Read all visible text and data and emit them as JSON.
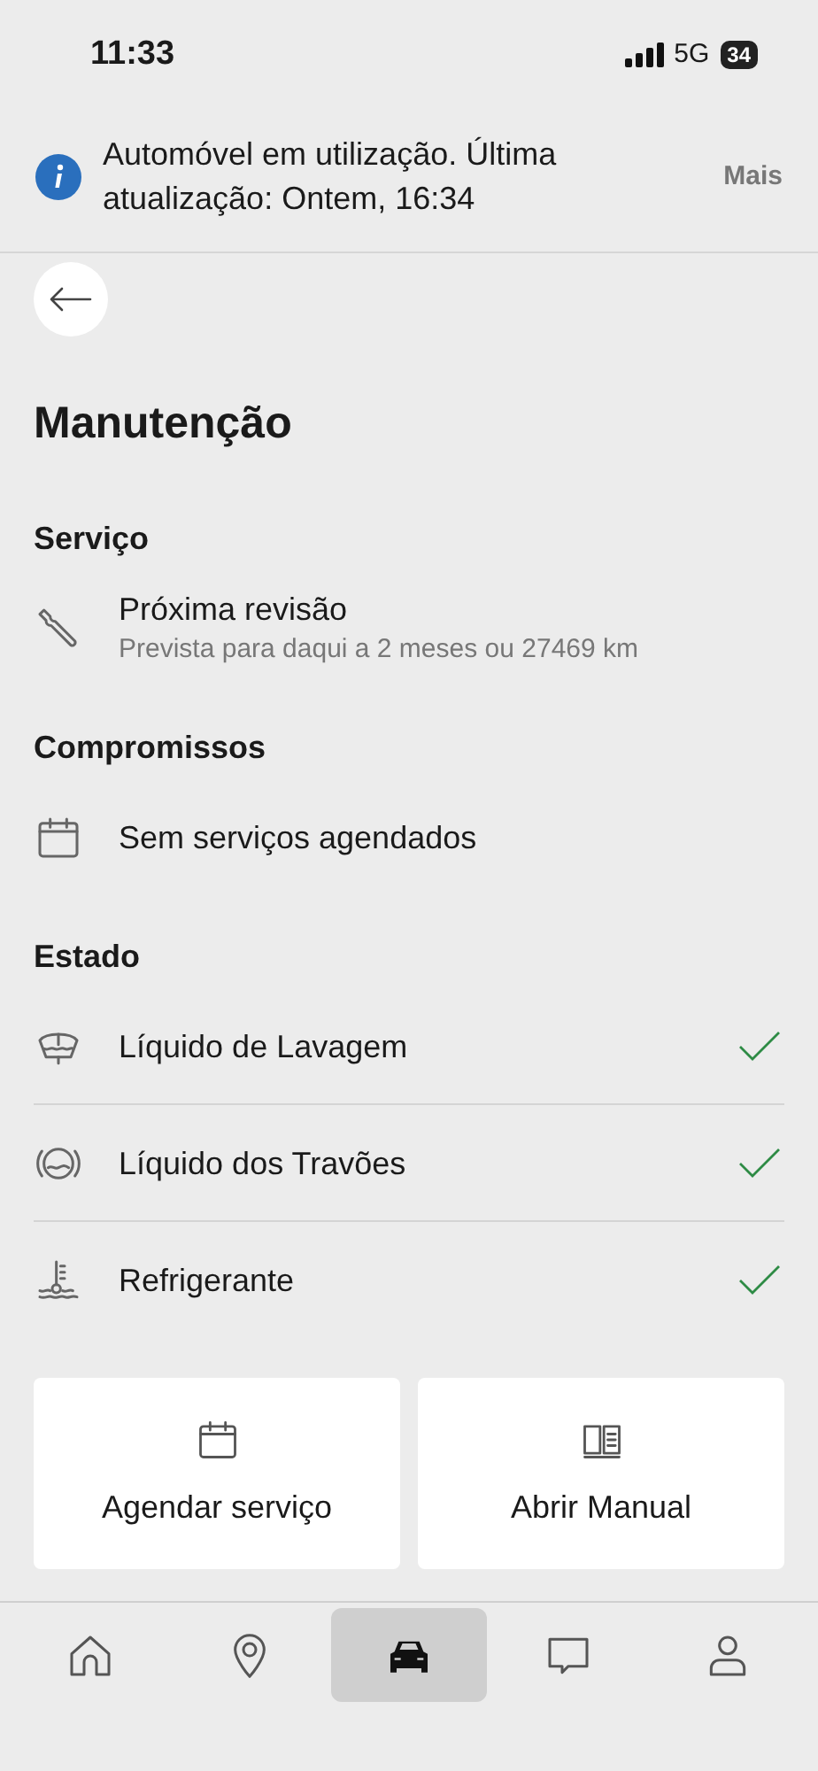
{
  "status_bar": {
    "time": "11:33",
    "network": "5G",
    "battery": "34"
  },
  "banner": {
    "message": "Automóvel em utilização. Última atualização: Ontem, 16:34",
    "action": "Mais"
  },
  "title": "Manutenção",
  "sections": [
    {
      "heading": "Serviço",
      "items": [
        {
          "kind": "wrench",
          "label": "Próxima revisão",
          "detail": "Prevista para daqui a 2 meses ou 27469 km"
        }
      ]
    },
    {
      "heading": "Compromissos",
      "items": [
        {
          "kind": "calendar",
          "label": "Sem serviços agendados"
        }
      ]
    },
    {
      "heading": "Estado",
      "items": [
        {
          "kind": "washer",
          "label": "Líquido de Lavagem",
          "ok": true
        },
        {
          "kind": "brake",
          "label": "Líquido dos Travões",
          "ok": true
        },
        {
          "kind": "coolant",
          "label": "Refrigerante",
          "ok": true
        }
      ]
    }
  ],
  "actions": [
    {
      "kind": "calendar",
      "label": "Agendar serviço"
    },
    {
      "kind": "book",
      "label": "Abrir Manual"
    }
  ],
  "nav": [
    {
      "kind": "home",
      "selected": false
    },
    {
      "kind": "pin",
      "selected": false
    },
    {
      "kind": "car",
      "selected": true
    },
    {
      "kind": "chat",
      "selected": false
    },
    {
      "kind": "person",
      "selected": false
    }
  ]
}
